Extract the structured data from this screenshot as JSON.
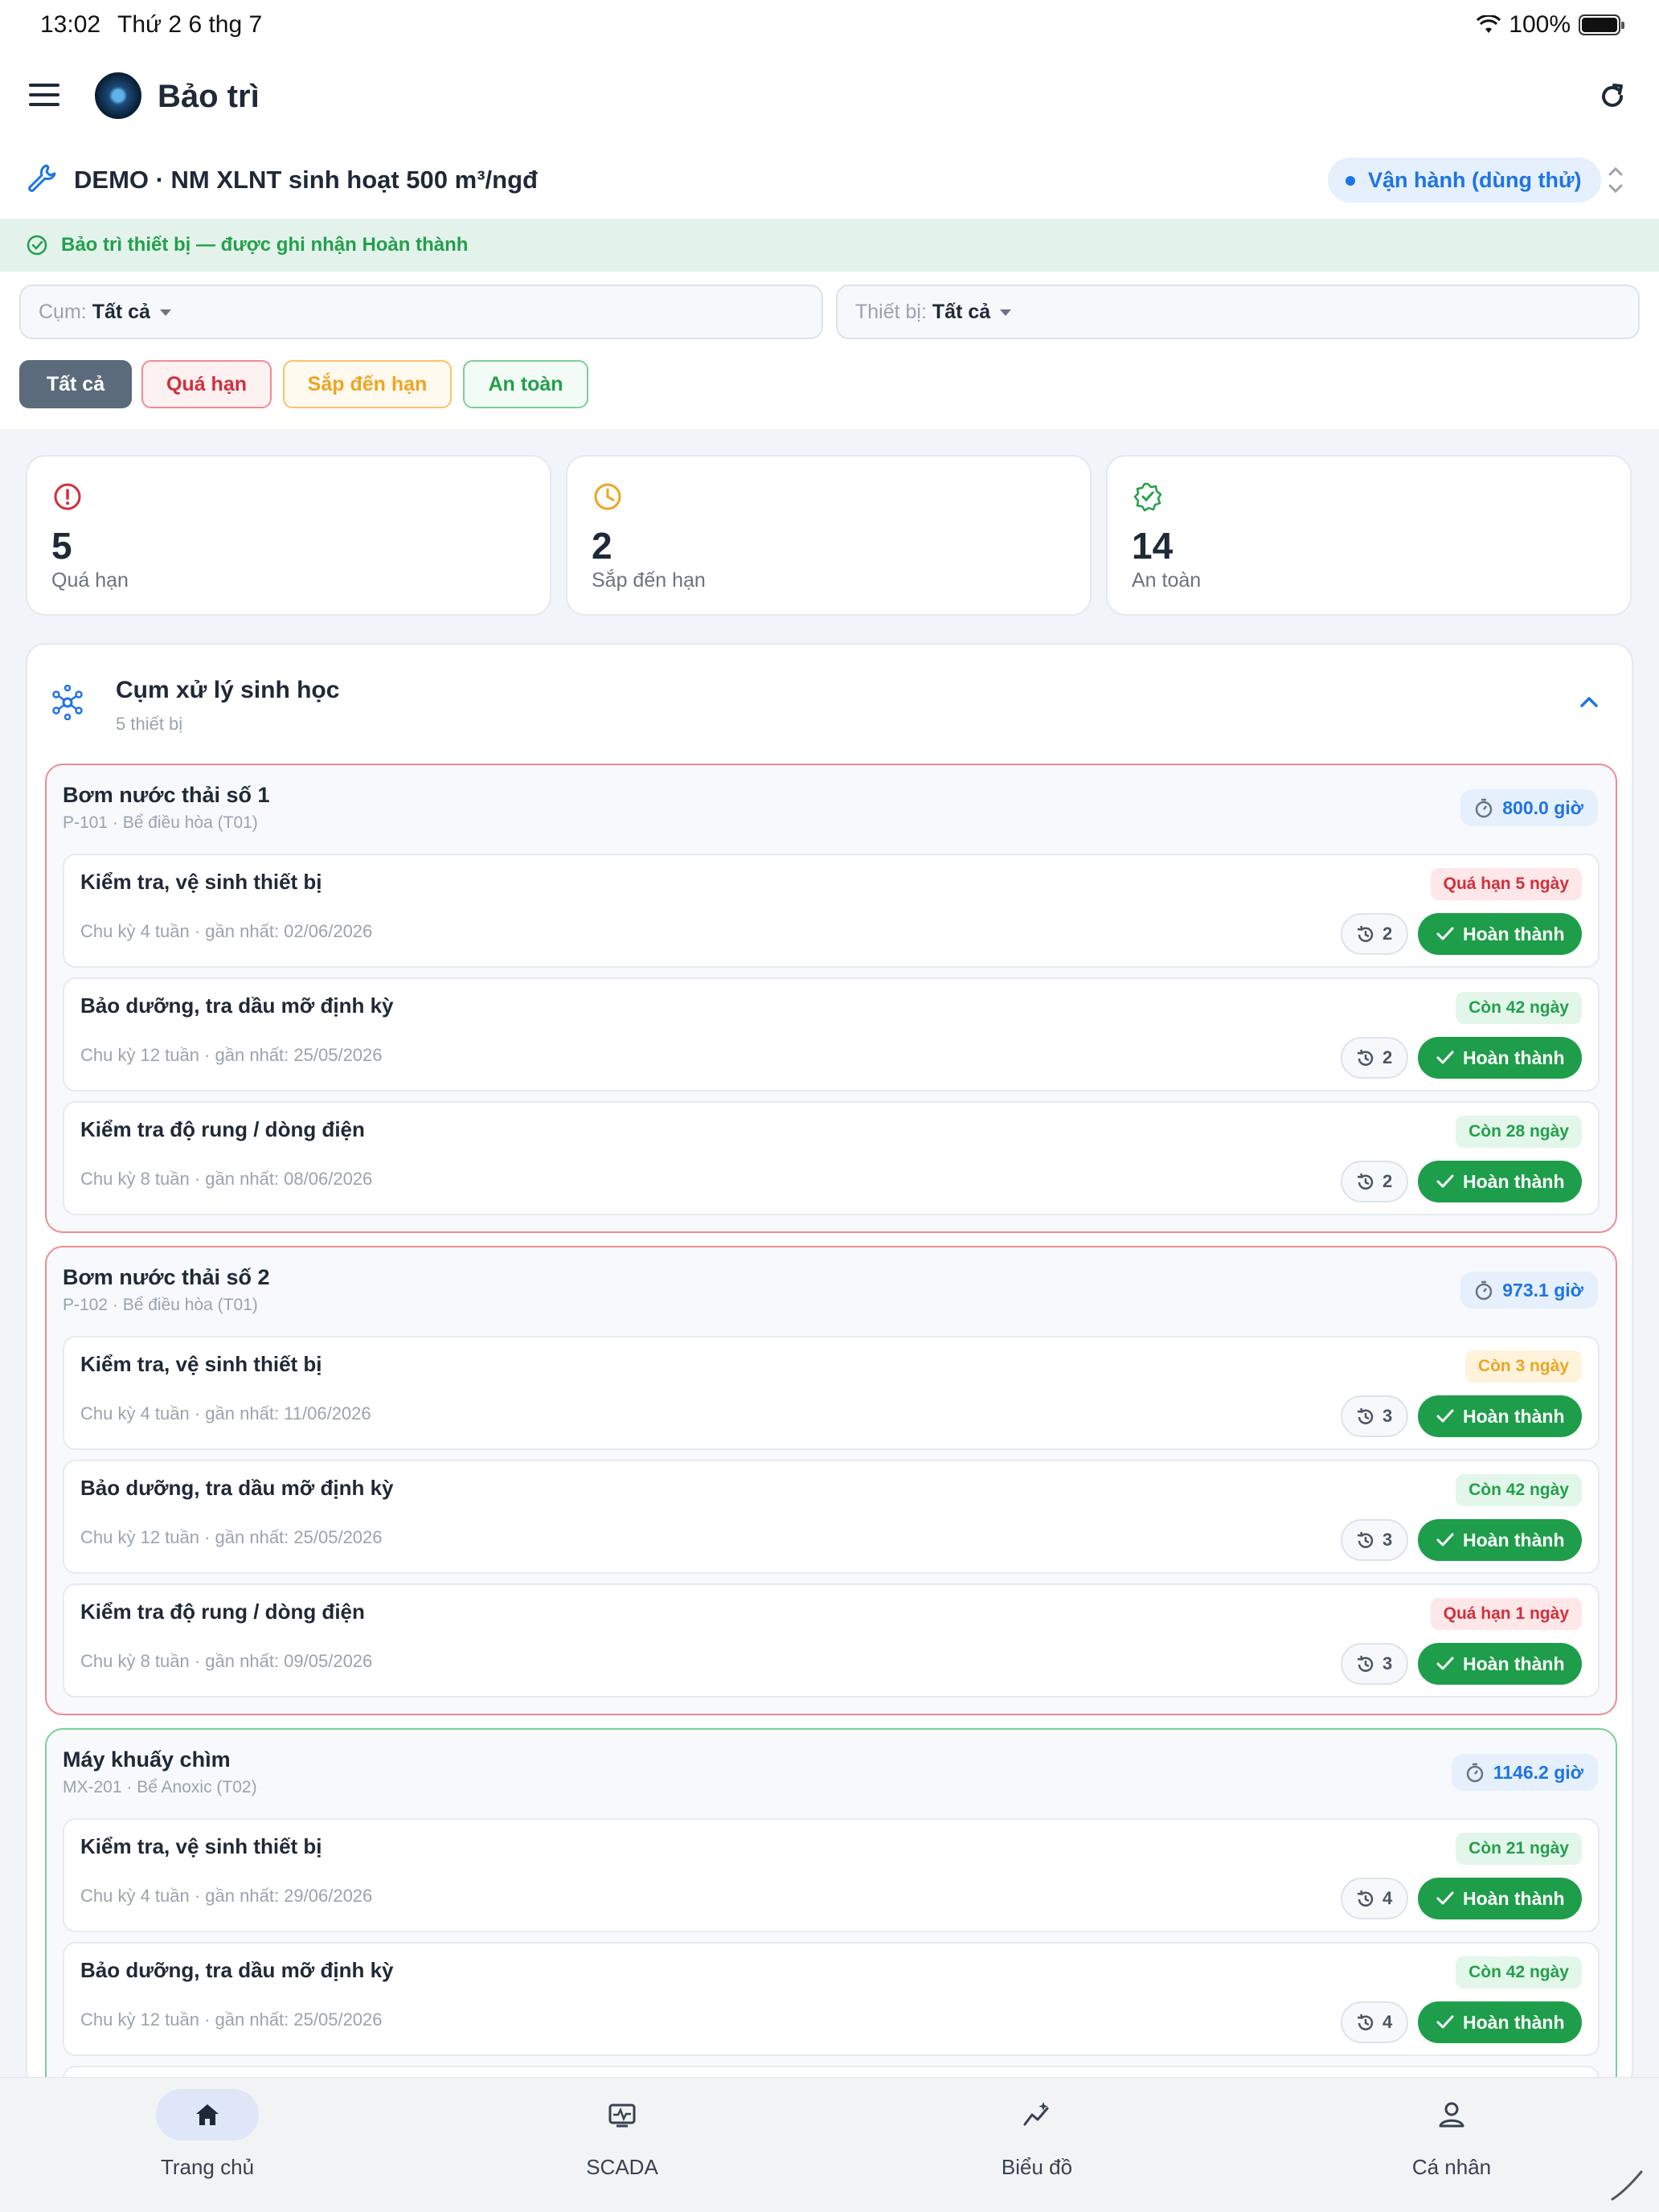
{
  "status_bar": {
    "time": "13:02",
    "date": "Thứ 2 6 thg 7",
    "battery": "100%"
  },
  "app_bar": {
    "title": "Bảo trì"
  },
  "plant": {
    "name": "DEMO · NM XLNT sinh hoạt 500 m³/ngđ",
    "mode": "Vận hành (dùng thử)"
  },
  "banner": {
    "text": "Bảo trì thiết bị — được ghi nhận Hoàn thành"
  },
  "filters": {
    "cluster_label": "Cụm:",
    "cluster_value": "Tất cả",
    "device_label": "Thiết bị:",
    "device_value": "Tất cả",
    "chips": [
      "Tất cả",
      "Quá hạn",
      "Sắp đến hạn",
      "An toàn"
    ]
  },
  "stats": [
    {
      "value": "5",
      "label": "Quá hạn",
      "color": "#d32f3b"
    },
    {
      "value": "2",
      "label": "Sắp đến hạn",
      "color": "#f0a422"
    },
    {
      "value": "14",
      "label": "An toàn",
      "color": "#22a04b"
    }
  ],
  "group": {
    "title": "Cụm xử lý sinh học",
    "subtitle": "5 thiết bị",
    "equipment": [
      {
        "name": "Bơm nước thải số 1",
        "sub": "P-101 · Bể điều hòa (T01)",
        "hours": "800.0 giờ",
        "tasks": [
          {
            "name": "Kiểm tra, vệ sinh thiết bị",
            "meta": "Chu kỳ 4 tuần · gần nhất: 02/06/2026",
            "status": "Quá hạn 5 ngày",
            "history": "2"
          },
          {
            "name": "Bảo dưỡng, tra dầu mỡ định kỳ",
            "meta": "Chu kỳ 12 tuần · gần nhất: 25/05/2026",
            "status": "Còn 42 ngày",
            "history": "2"
          },
          {
            "name": "Kiểm tra độ rung / dòng điện",
            "meta": "Chu kỳ 8 tuần · gần nhất: 08/06/2026",
            "status": "Còn 28 ngày",
            "history": "2"
          }
        ]
      },
      {
        "name": "Bơm nước thải số 2",
        "sub": "P-102 · Bể điều hòa (T01)",
        "hours": "973.1 giờ",
        "tasks": [
          {
            "name": "Kiểm tra, vệ sinh thiết bị",
            "meta": "Chu kỳ 4 tuần · gần nhất: 11/06/2026",
            "status": "Còn 3 ngày",
            "history": "3"
          },
          {
            "name": "Bảo dưỡng, tra dầu mỡ định kỳ",
            "meta": "Chu kỳ 12 tuần · gần nhất: 25/05/2026",
            "status": "Còn 42 ngày",
            "history": "3"
          },
          {
            "name": "Kiểm tra độ rung / dòng điện",
            "meta": "Chu kỳ 8 tuần · gần nhất: 09/05/2026",
            "status": "Quá hạn 1 ngày",
            "history": "3"
          }
        ]
      },
      {
        "name": "Máy khuấy chìm",
        "sub": "MX-201 · Bể Anoxic (T02)",
        "hours": "1146.2 giờ",
        "tasks": [
          {
            "name": "Kiểm tra, vệ sinh thiết bị",
            "meta": "Chu kỳ 4 tuần · gần nhất: 29/06/2026",
            "status": "Còn 21 ngày",
            "history": "4"
          },
          {
            "name": "Bảo dưỡng, tra dầu mỡ định kỳ",
            "meta": "Chu kỳ 12 tuần · gần nhất: 25/05/2026",
            "status": "Còn 42 ngày",
            "history": "4"
          }
        ]
      }
    ]
  },
  "done_label": "Hoàn thành",
  "bottom_nav": [
    "Trang chủ",
    "SCADA",
    "Biểu đồ",
    "Cá nhân"
  ]
}
